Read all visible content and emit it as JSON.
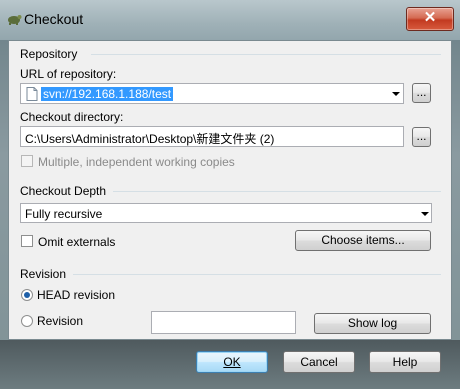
{
  "window": {
    "title": "Checkout",
    "close_symbol": "✕"
  },
  "repository": {
    "group_label": "Repository",
    "url_label": "URL of repository:",
    "url_value": "svn://192.168.1.188/test",
    "browse_label": "...",
    "checkout_dir_label": "Checkout directory:",
    "checkout_dir_value": "C:\\Users\\Administrator\\Desktop\\新建文件夹 (2)",
    "multiple_label": "Multiple, independent working copies",
    "multiple_checked": false
  },
  "depth": {
    "group_label": "Checkout Depth",
    "value": "Fully recursive",
    "omit_externals_label": "Omit externals",
    "omit_externals_checked": false,
    "choose_items_label": "Choose items..."
  },
  "revision": {
    "group_label": "Revision",
    "head_label": "HEAD revision",
    "head_selected": true,
    "revision_label": "Revision",
    "revision_value": "",
    "show_log_label": "Show log"
  },
  "buttons": {
    "ok": "OK",
    "cancel": "Cancel",
    "help": "Help"
  }
}
